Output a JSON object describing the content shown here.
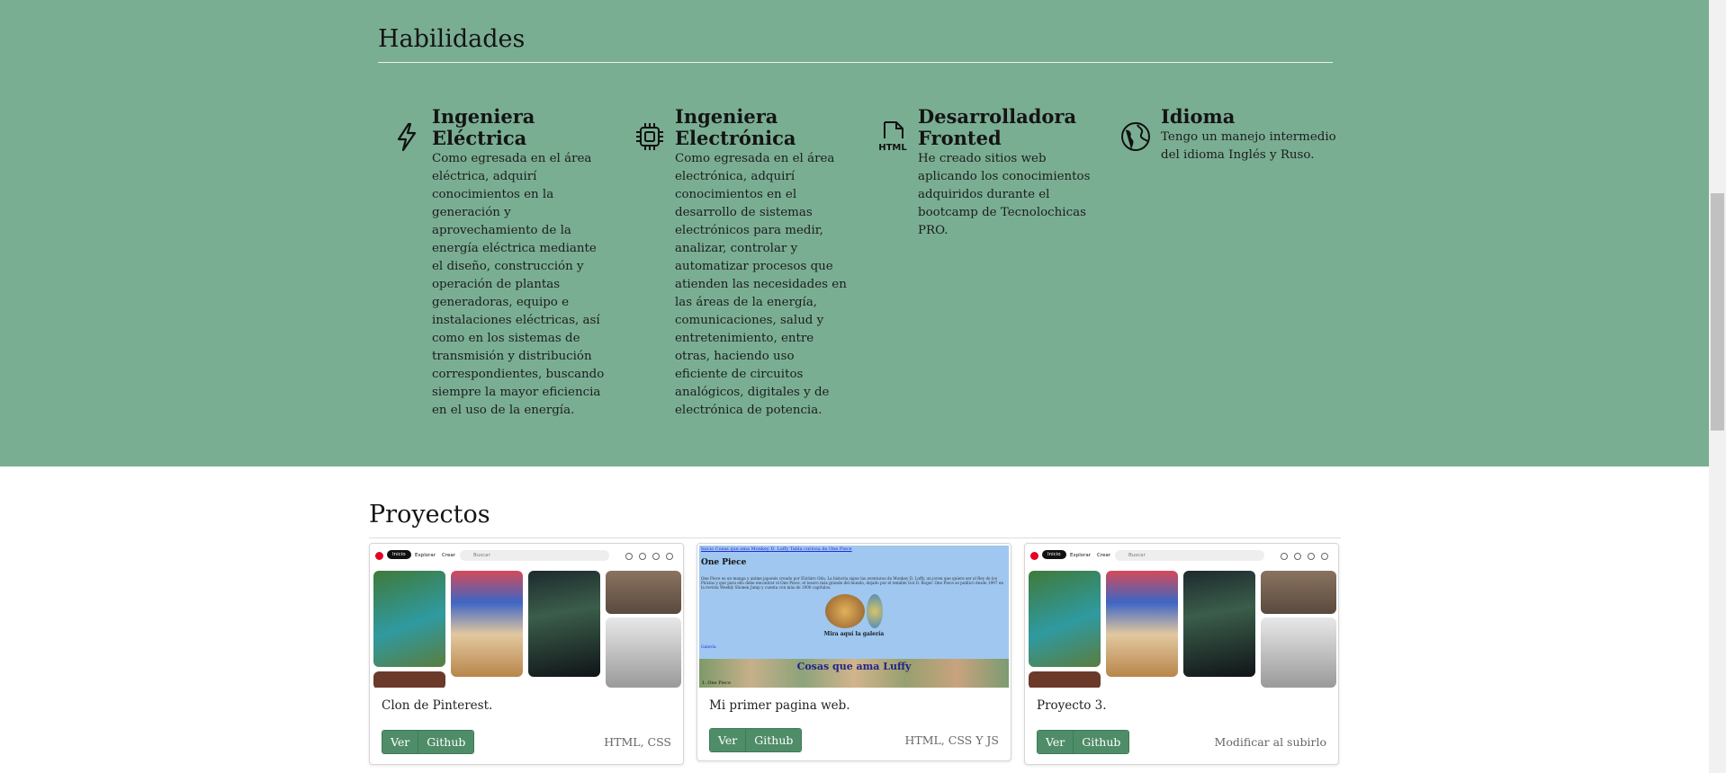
{
  "skills": {
    "title": "Habilidades",
    "items": [
      {
        "icon": "bolt-icon",
        "title": "Ingeniera Eléctrica",
        "description": "Como egresada en el área eléctrica, adquirí conocimientos en la generación y aprovechamiento de la energía eléctrica mediante el diseño, construcción y operación de plantas generadoras, equipo e instalaciones eléctricas, así como en los sistemas de transmisión y distribución correspondientes, buscando siempre la mayor eficiencia en el uso de la energía."
      },
      {
        "icon": "cpu-chip-icon",
        "title": "Ingeniera Electrónica",
        "description": "Como egresada en el área electrónica, adquirí conocimientos en el desarrollo de sistemas electrónicos para medir, analizar, controlar y automatizar procesos que atienden las necesidades en las áreas de la energía, comunicaciones, salud y entretenimiento, entre otras, haciendo uso eficiente de circuitos analógicos, digitales y de electrónica de potencia."
      },
      {
        "icon": "html-file-icon",
        "title": "Desarrolladora Fronted",
        "description": "He creado sitios web aplicando los conocimientos adquiridos durante el bootcamp de Tecnolochicas PRO."
      },
      {
        "icon": "globe-icon",
        "title": "Idioma",
        "description": "Tengo un manejo intermedio del idioma Inglés y Ruso."
      }
    ]
  },
  "projects": {
    "title": "Proyectos",
    "cards": [
      {
        "title": "Clon de Pinterest.",
        "ver_label": "Ver",
        "github_label": "Github",
        "tech": "HTML, CSS",
        "thumb": {
          "nav_inicio": "Inicio",
          "nav_explorar": "Explorar",
          "nav_crear": "Crear",
          "search_placeholder": "Buscar"
        }
      },
      {
        "title": "Mi primer pagina web.",
        "ver_label": "Ver",
        "github_label": "Github",
        "tech": "HTML, CSS Y JS",
        "thumb": {
          "links": "Inicio  Cosas que ama Monkey D. Luffy  Tabla curiosa de One Piece",
          "heading": "One Piece",
          "paragraph": "One Piece es un manga y anime japonés creado por Eiichiro Oda. La historia sigue las aventuras de Monkey D. Luffy, un joven que quiere ser el Rey de los Piratas y que para ello debe encontrar el One Piece, el tesoro más grande del mundo, dejado por el temible Gol D. Roger. One Piece se publicó desde 1997 en la revista Weekly Shonen Jump y cuenta con más de 1000 capítulos.",
          "gallery_caption": "Mira aquí la galería",
          "gallery_link": "Galería",
          "section_heading": "Cosas que ama Luffy",
          "list_item": "1. One Piece"
        }
      },
      {
        "title": "Proyecto 3.",
        "ver_label": "Ver",
        "github_label": "Github",
        "tech": "Modificar al subirlo",
        "thumb": {
          "nav_inicio": "Inicio",
          "nav_explorar": "Explorar",
          "nav_crear": "Crear",
          "search_placeholder": "Buscar"
        }
      }
    ]
  },
  "colors": {
    "skills_bg": "#7aae93",
    "button_green": "#4f8c68"
  }
}
